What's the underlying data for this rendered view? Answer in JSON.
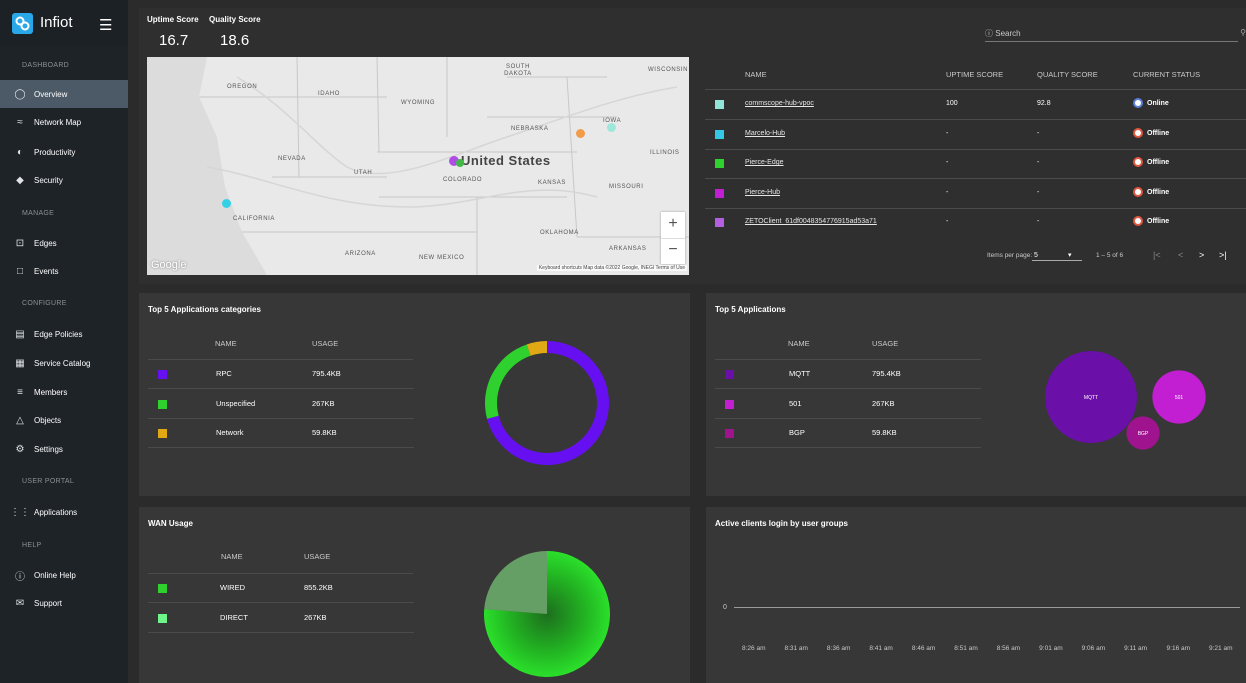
{
  "app": {
    "name": "Infiot"
  },
  "sidebar": {
    "sections": [
      {
        "label": "DASHBOARD"
      },
      {
        "label": "MANAGE"
      },
      {
        "label": "CONFIGURE"
      },
      {
        "label": "USER PORTAL"
      },
      {
        "label": "HELP"
      }
    ],
    "items": [
      {
        "label": "Overview",
        "icon": "overview-icon"
      },
      {
        "label": "Network Map",
        "icon": "network-icon"
      },
      {
        "label": "Productivity",
        "icon": "productivity-icon"
      },
      {
        "label": "Security",
        "icon": "shield-icon"
      },
      {
        "label": "Edges",
        "icon": "edges-icon"
      },
      {
        "label": "Events",
        "icon": "calendar-icon"
      },
      {
        "label": "Edge Policies",
        "icon": "policy-icon"
      },
      {
        "label": "Service Catalog",
        "icon": "catalog-icon"
      },
      {
        "label": "Members",
        "icon": "members-icon"
      },
      {
        "label": "Objects",
        "icon": "objects-icon"
      },
      {
        "label": "Settings",
        "icon": "gear-icon"
      },
      {
        "label": "Applications",
        "icon": "apps-icon"
      },
      {
        "label": "Online Help",
        "icon": "help-icon"
      },
      {
        "label": "Support",
        "icon": "mail-icon"
      }
    ]
  },
  "scores": {
    "uptime_label": "Uptime Score",
    "quality_label": "Quality Score",
    "uptime_value": "16.7",
    "quality_value": "18.6"
  },
  "search": {
    "placeholder": "Search"
  },
  "map": {
    "labels": [
      "OREGON",
      "IDAHO",
      "WYOMING",
      "SOUTH DAKOTA",
      "WISCONSIN",
      "NEBRASKA",
      "IOWA",
      "NEVADA",
      "UTAH",
      "ILLINOIS",
      "COLORADO",
      "KANSAS",
      "MISSOURI",
      "CALIFORNIA",
      "OKLAHOMA",
      "ARKANSAS",
      "ARIZONA",
      "NEW MEXICO"
    ],
    "country": "United States",
    "google": "Google",
    "footer": "Keyboard shortcuts   Map data ©2022 Google, INEGI   Terms of Use",
    "zoom_in": "+",
    "zoom_out": "−"
  },
  "edges_table": {
    "headers": [
      "NAME",
      "UPTIME SCORE",
      "QUALITY SCORE",
      "CURRENT STATUS"
    ],
    "rows": [
      {
        "color": "#8fe6d6",
        "name": "commscope-hub-vpoc",
        "uptime": "100",
        "quality": "92.8",
        "status": "Online",
        "status_color": "#5b7fd6"
      },
      {
        "color": "#33c9e6",
        "name": "Marcelo-Hub",
        "uptime": "-",
        "quality": "-",
        "status": "Offline",
        "status_color": "#e0573f"
      },
      {
        "color": "#2ed12e",
        "name": "Pierce-Edge",
        "uptime": "-",
        "quality": "-",
        "status": "Offline",
        "status_color": "#e0573f"
      },
      {
        "color": "#c11fd1",
        "name": "Pierce-Hub",
        "uptime": "-",
        "quality": "-",
        "status": "Offline",
        "status_color": "#e0573f"
      },
      {
        "color": "#b45ee0",
        "name": "ZETOClient_61df0048354776915ad53a71",
        "uptime": "-",
        "quality": "-",
        "status": "Offline",
        "status_color": "#e0573f"
      }
    ],
    "pagination": {
      "items_per_page_label": "Items per page:",
      "items_per_page": "5",
      "range": "1 – 5 of 6",
      "first": "|<",
      "prev": "<",
      "next": ">",
      "last": ">|"
    }
  },
  "app_categories": {
    "title": "Top 5 Applications categories",
    "headers": [
      "NAME",
      "USAGE"
    ],
    "rows": [
      {
        "name": "RPC",
        "usage": "795.4KB",
        "color": "#6610f2"
      },
      {
        "name": "Unspecified",
        "usage": "267KB",
        "color": "#2ed12e"
      },
      {
        "name": "Network",
        "usage": "59.8KB",
        "color": "#e0a814"
      }
    ]
  },
  "top_apps": {
    "title": "Top 5 Applications",
    "headers": [
      "NAME",
      "USAGE"
    ],
    "rows": [
      {
        "name": "MQTT",
        "usage": "795.4KB",
        "color": "#6a0fa8"
      },
      {
        "name": "501",
        "usage": "267KB",
        "color": "#c11fd1"
      },
      {
        "name": "BGP",
        "usage": "59.8KB",
        "color": "#a0138e"
      }
    ]
  },
  "wan": {
    "title": "WAN Usage",
    "headers": [
      "NAME",
      "USAGE"
    ],
    "rows": [
      {
        "name": "WIRED",
        "usage": "855.2KB",
        "color": "#2ed12e"
      },
      {
        "name": "DIRECT",
        "usage": "267KB",
        "color": "#6ef58a"
      }
    ]
  },
  "clients": {
    "title": "Active clients login by user groups",
    "y_tick": "0",
    "x_ticks": [
      "8:26 am",
      "8:31 am",
      "8:36 am",
      "8:41 am",
      "8:46 am",
      "8:51 am",
      "8:56 am",
      "9:01 am",
      "9:06 am",
      "9:11 am",
      "9:16 am",
      "9:21 am"
    ]
  },
  "chart_data": [
    {
      "type": "pie",
      "title": "Top 5 Applications categories",
      "categories": [
        "RPC",
        "Unspecified",
        "Network"
      ],
      "values": [
        795.4,
        267,
        59.8
      ],
      "unit": "KB"
    },
    {
      "type": "scatter",
      "title": "Top 5 Applications",
      "categories": [
        "MQTT",
        "501",
        "BGP"
      ],
      "values": [
        795.4,
        267,
        59.8
      ],
      "unit": "KB"
    },
    {
      "type": "pie",
      "title": "WAN Usage",
      "categories": [
        "WIRED",
        "DIRECT"
      ],
      "values": [
        855.2,
        267
      ],
      "unit": "KB"
    },
    {
      "type": "line",
      "title": "Active clients login by user groups",
      "x": [
        "8:26 am",
        "8:31 am",
        "8:36 am",
        "8:41 am",
        "8:46 am",
        "8:51 am",
        "8:56 am",
        "9:01 am",
        "9:06 am",
        "9:11 am",
        "9:16 am",
        "9:21 am"
      ],
      "values": [
        0,
        0,
        0,
        0,
        0,
        0,
        0,
        0,
        0,
        0,
        0,
        0
      ]
    }
  ]
}
